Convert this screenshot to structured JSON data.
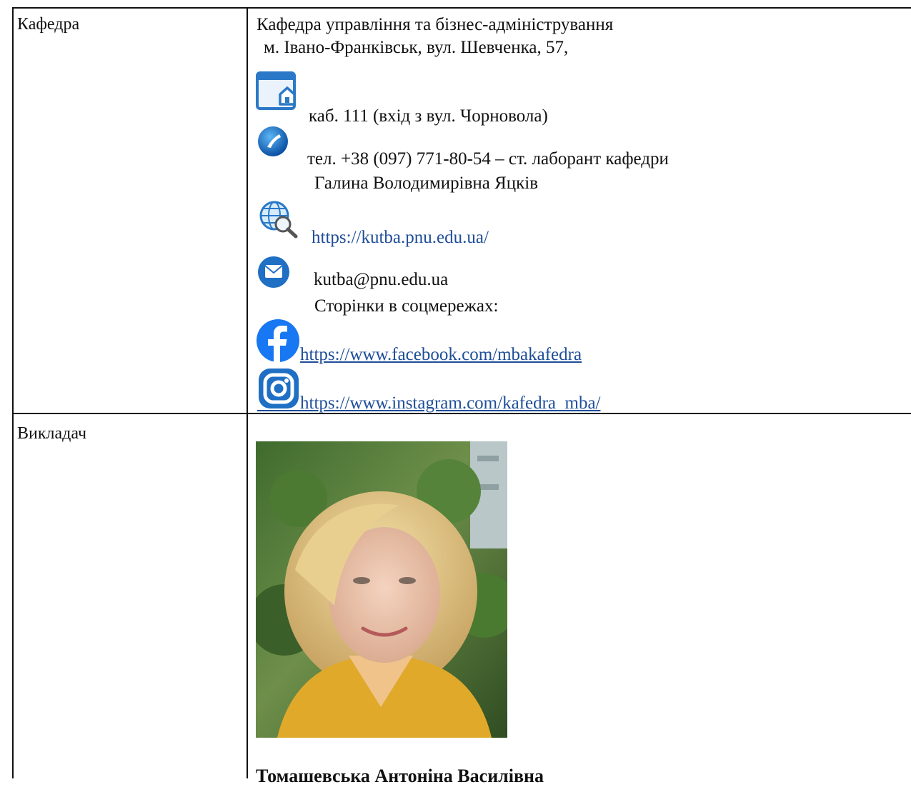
{
  "rows": {
    "department_label": "Кафедра",
    "lecturer_label": "Викладач"
  },
  "department": {
    "name": "Кафедра управління та бізнес-адміністрування",
    "address": "м. Івано-Франківськ, вул. Шевченка, 57,",
    "room": "каб. 111 (вхід з вул. Чорновола)",
    "phone": "тел. +38 (097) 771-80-54 –  ст. лаборант кафедри",
    "lab_assistant": "Галина Володимирівна Яцків",
    "website": "https://kutba.pnu.edu.ua/",
    "email": "kutba@pnu.edu.ua",
    "social_heading": "Сторінки в соцмережах:",
    "facebook": "https://www.facebook.com/mbakafedra",
    "instagram": "https://www.instagram.com/kafedra_mba/"
  },
  "lecturer": {
    "name": "Томашевська Антоніна Василівна"
  },
  "icons": {
    "building": "home-window-icon",
    "phone": "phone-icon",
    "web": "globe-search-icon",
    "email": "envelope-icon",
    "facebook": "facebook-icon",
    "instagram": "instagram-icon"
  },
  "colors": {
    "link": "#1f4e99",
    "facebook": "#1877f2",
    "icon_blue": "#2a78c7"
  }
}
